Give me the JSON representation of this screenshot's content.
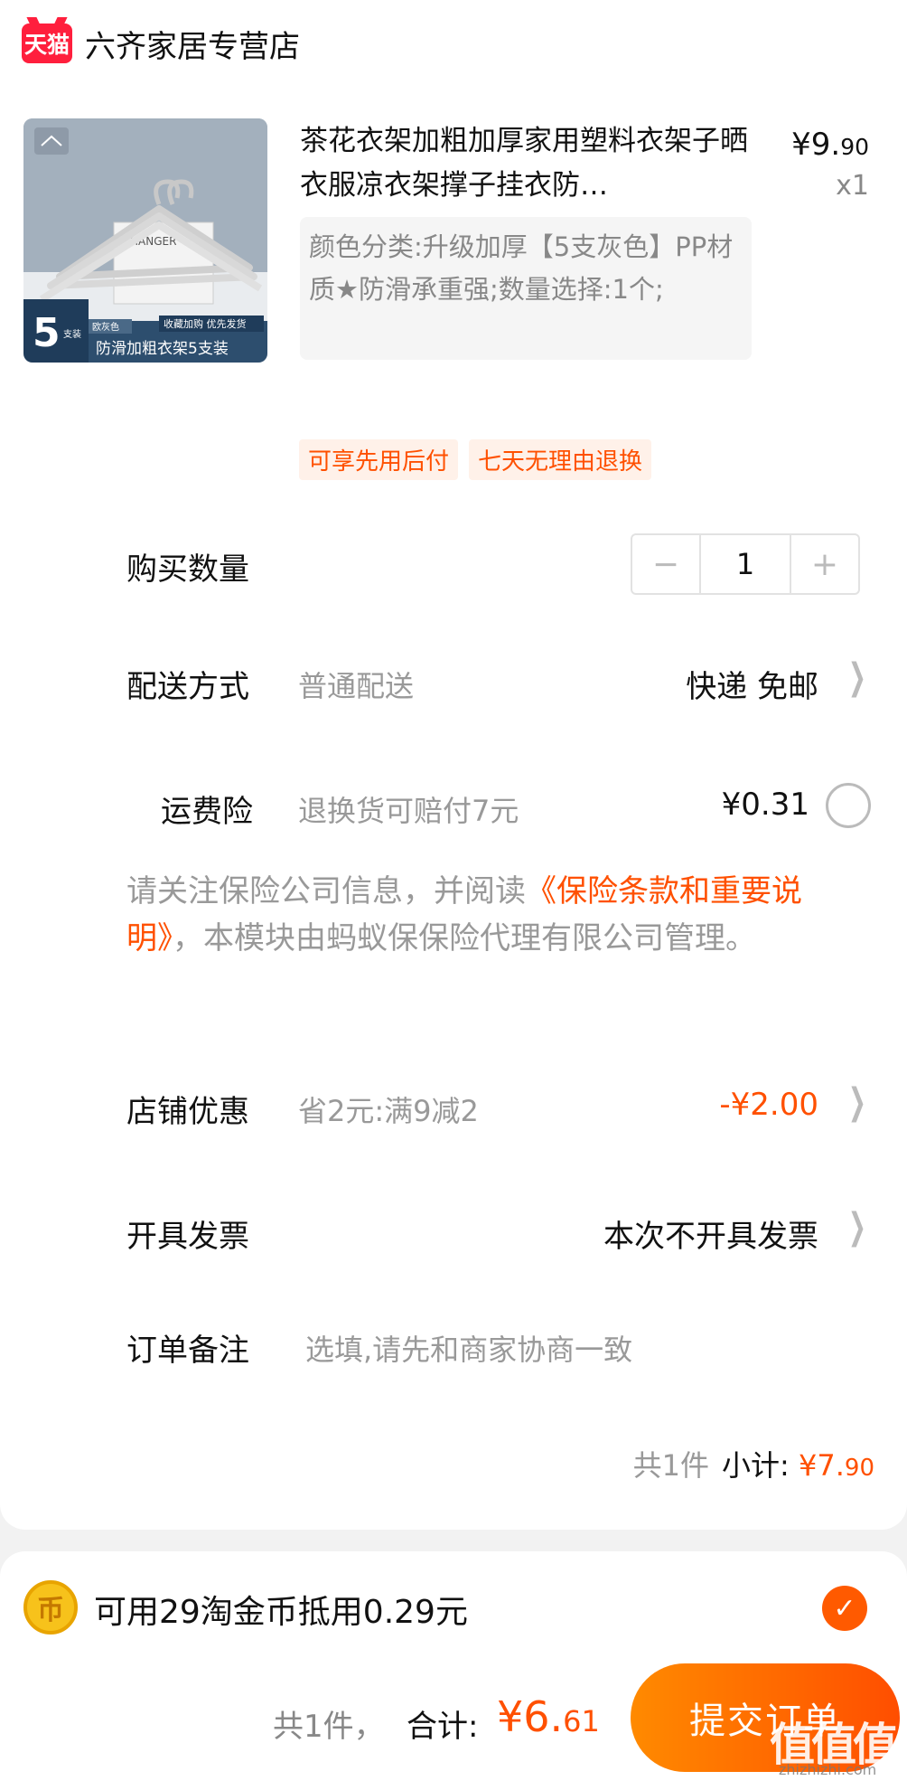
{
  "store": {
    "logo_text": "天猫",
    "name": "六齐家居专营店"
  },
  "product": {
    "title": "茶花衣架加粗加厚家用塑料衣架子晒衣服凉衣架撑子挂衣防…",
    "price_main": "¥9.",
    "price_decimal": "90",
    "quantity_label": "x1",
    "sku": "颜色分类:升级加厚【5支灰色】PP材质★防滑承重强;数量选择:1个;",
    "thumb": {
      "badge_number": "5",
      "badge_unit": "支装",
      "color_tag": "欧灰色",
      "promo_tag": "收藏加购 优先发货",
      "caption": "防滑加粗衣架5支装",
      "box_label": "HANGER"
    }
  },
  "tags": [
    "可享先用后付",
    "七天无理由退换"
  ],
  "quantity": {
    "label": "购买数量",
    "minus": "−",
    "value": "1",
    "plus": "+"
  },
  "delivery": {
    "label": "配送方式",
    "sub": "普通配送",
    "value": "快递 免邮"
  },
  "insurance": {
    "label": "运费险",
    "sub": "退换货可赔付7元",
    "value": "¥0.31",
    "notice_before": "请关注保险公司信息，并阅读",
    "notice_link": "《保险条款和重要说明》",
    "notice_after": "，本模块由蚂蚁保保险代理有限公司管理。"
  },
  "discount": {
    "label": "店铺优惠",
    "sub": "省2元:满9减2",
    "value": "-¥2.00"
  },
  "invoice": {
    "label": "开具发票",
    "value": "本次不开具发票"
  },
  "remark": {
    "label": "订单备注",
    "placeholder": "选填,请先和商家协商一致"
  },
  "subtotal": {
    "count": "共1件",
    "label": "小计:",
    "amount_main": "¥7.",
    "amount_decimal": "90"
  },
  "coins": {
    "icon_text": "币",
    "text": "可用29淘金币抵用0.29元",
    "checked": true
  },
  "footer": {
    "count": "共1件，",
    "total_label": "合计:",
    "total_main": "¥6.",
    "total_decimal": "61",
    "submit_label": "提交订单"
  },
  "watermark": {
    "logo": "值值值",
    "url": "zhizhizhi.com"
  },
  "colors": {
    "accent": "#ff5000",
    "tmall_red": "#ff1f3d"
  }
}
